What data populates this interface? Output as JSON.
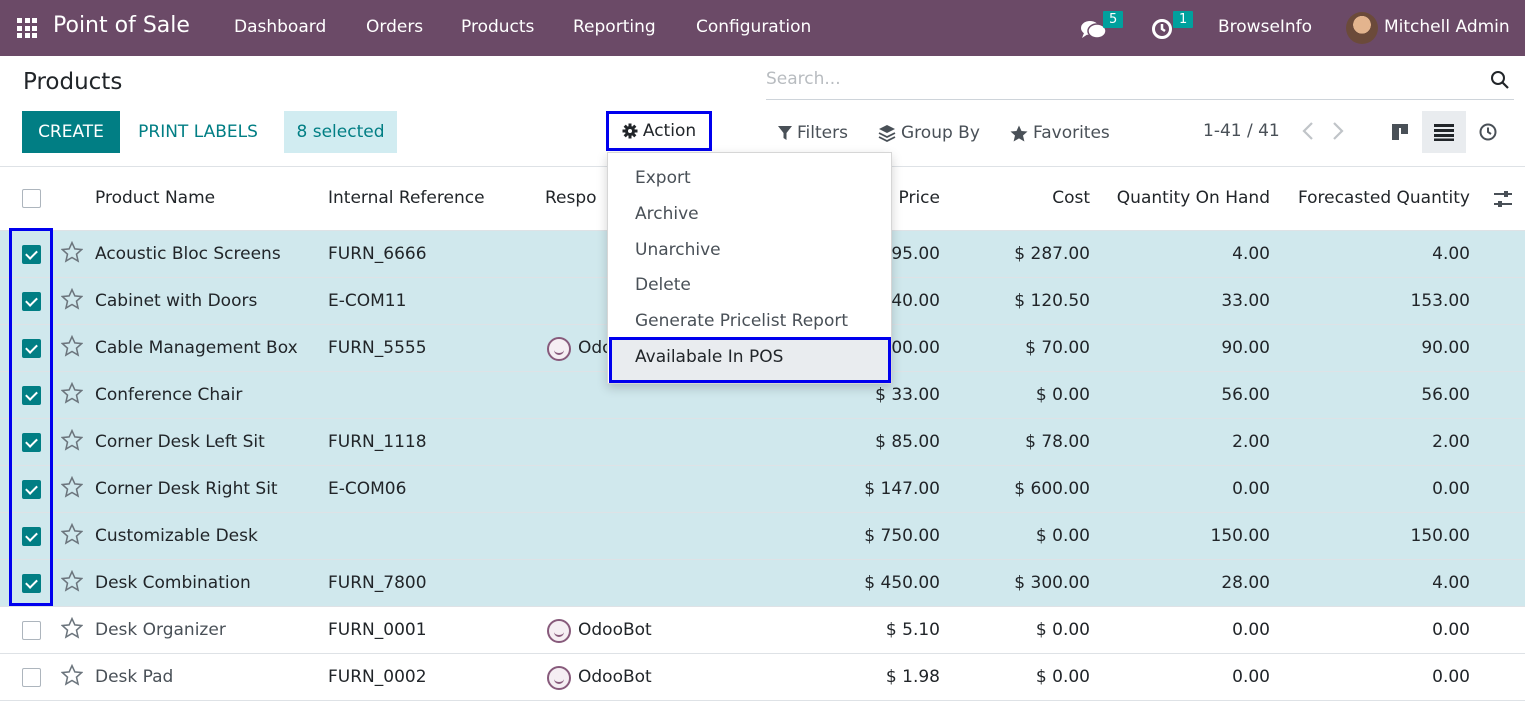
{
  "navbar": {
    "app_title": "Point of Sale",
    "menus": [
      "Dashboard",
      "Orders",
      "Products",
      "Reporting",
      "Configuration"
    ],
    "messages_count": "5",
    "activities_count": "1",
    "company": "BrowseInfo",
    "user": "Mitchell Admin"
  },
  "control_panel": {
    "title": "Products",
    "search_placeholder": "Search...",
    "create_label": "CREATE",
    "print_labels_label": "PRINT LABELS",
    "selected_label": "8 selected",
    "action_label": "Action",
    "filters_label": "Filters",
    "group_by_label": "Group By",
    "favorites_label": "Favorites",
    "pager": "1-41 / 41"
  },
  "action_menu": {
    "items": [
      "Export",
      "Archive",
      "Unarchive",
      "Delete",
      "Generate Pricelist Report",
      "Availabale In POS"
    ]
  },
  "table": {
    "columns": [
      "Product Name",
      "Internal Reference",
      "Respo",
      "Price",
      "Cost",
      "Quantity On Hand",
      "Forecasted Quantity"
    ],
    "rows": [
      {
        "selected": true,
        "name": "Acoustic Bloc Screens",
        "ref": "FURN_6666",
        "responsible": "",
        "price": "95.00",
        "cost": "$ 287.00",
        "qty": "4.00",
        "forecast": "4.00"
      },
      {
        "selected": true,
        "name": "Cabinet with Doors",
        "ref": "E-COM11",
        "responsible": "",
        "price": "40.00",
        "cost": "$ 120.50",
        "qty": "33.00",
        "forecast": "153.00"
      },
      {
        "selected": true,
        "name": "Cable Management Box",
        "ref": "FURN_5555",
        "responsible": "Odo",
        "price": "00.00",
        "cost": "$ 70.00",
        "qty": "90.00",
        "forecast": "90.00"
      },
      {
        "selected": true,
        "name": "Conference Chair",
        "ref": "",
        "responsible": "",
        "price": "$ 33.00",
        "cost": "$ 0.00",
        "qty": "56.00",
        "forecast": "56.00"
      },
      {
        "selected": true,
        "name": "Corner Desk Left Sit",
        "ref": "FURN_1118",
        "responsible": "",
        "price": "$ 85.00",
        "cost": "$ 78.00",
        "qty": "2.00",
        "forecast": "2.00"
      },
      {
        "selected": true,
        "name": "Corner Desk Right Sit",
        "ref": "E-COM06",
        "responsible": "",
        "price": "$ 147.00",
        "cost": "$ 600.00",
        "qty": "0.00",
        "forecast": "0.00"
      },
      {
        "selected": true,
        "name": "Customizable Desk",
        "ref": "",
        "responsible": "",
        "price": "$ 750.00",
        "cost": "$ 0.00",
        "qty": "150.00",
        "forecast": "150.00"
      },
      {
        "selected": true,
        "name": "Desk Combination",
        "ref": "FURN_7800",
        "responsible": "",
        "price": "$ 450.00",
        "cost": "$ 300.00",
        "qty": "28.00",
        "forecast": "4.00"
      },
      {
        "selected": false,
        "name": "Desk Organizer",
        "ref": "FURN_0001",
        "responsible": "OdooBot",
        "price": "$ 5.10",
        "cost": "$ 0.00",
        "qty": "0.00",
        "forecast": "0.00"
      },
      {
        "selected": false,
        "name": "Desk Pad",
        "ref": "FURN_0002",
        "responsible": "OdooBot",
        "price": "$ 1.98",
        "cost": "$ 0.00",
        "qty": "0.00",
        "forecast": "0.00"
      }
    ]
  },
  "colors": {
    "navbar": "#6b4a67",
    "primary": "#017e84",
    "selected_row": "#d0e8ed",
    "highlight_outline": "#0000ee"
  }
}
